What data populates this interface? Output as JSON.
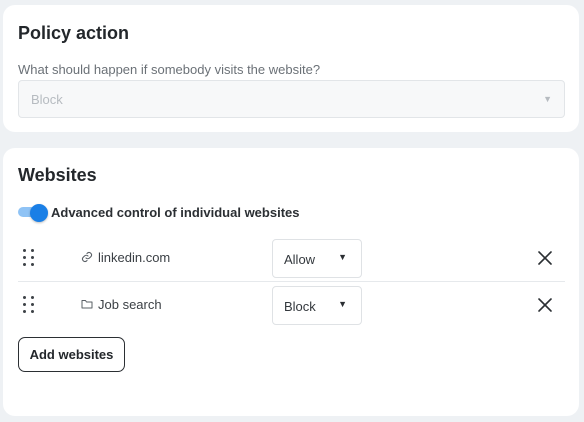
{
  "policy_action": {
    "title": "Policy action",
    "question": "What should happen if somebody visits the website?",
    "selected_value": "Block",
    "disabled": true
  },
  "websites": {
    "title": "Websites",
    "advanced_toggle": {
      "label": "Advanced control of individual websites",
      "on": true
    },
    "rows": [
      {
        "icon": "link-icon",
        "name": "linkedin.com",
        "action": "Allow"
      },
      {
        "icon": "folder-icon",
        "name": "Job search",
        "action": "Block"
      }
    ],
    "add_button_label": "Add websites"
  },
  "colors": {
    "accent": "#1a7fe6",
    "accent_track": "#8fc3f5",
    "page_background": "#eef1f4",
    "card_background": "#ffffff"
  }
}
